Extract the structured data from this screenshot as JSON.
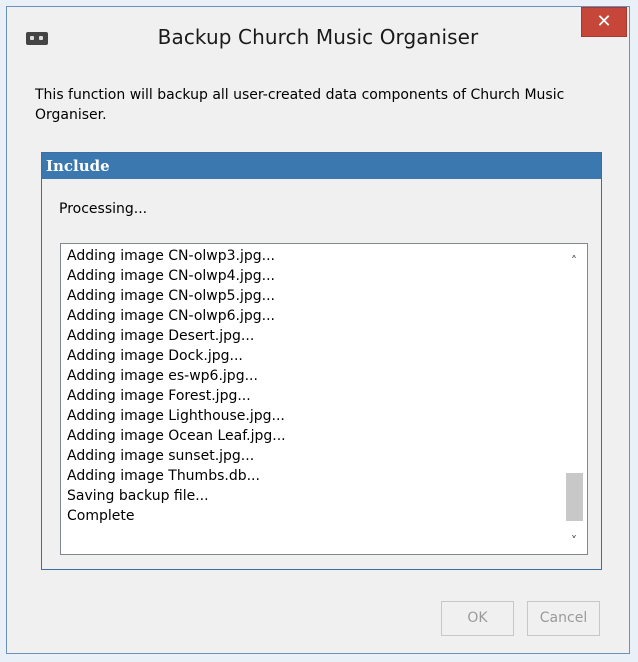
{
  "window": {
    "title": "Backup Church Music Organiser",
    "close_glyph": "✕"
  },
  "description": "This function will backup all user-created data components of Church Music Organiser.",
  "group": {
    "header": "Include",
    "status": "Processing..."
  },
  "log": [
    "Adding image CN-olwp3.jpg...",
    "Adding image CN-olwp4.jpg...",
    "Adding image CN-olwp5.jpg...",
    "Adding image CN-olwp6.jpg...",
    "Adding image Desert.jpg...",
    "Adding image Dock.jpg...",
    "Adding image es-wp6.jpg...",
    "Adding image Forest.jpg...",
    "Adding image Lighthouse.jpg...",
    "Adding image Ocean Leaf.jpg...",
    "Adding image sunset.jpg...",
    "Adding image Thumbs.db...",
    "Saving backup file...",
    "Complete"
  ],
  "buttons": {
    "ok": "OK",
    "cancel": "Cancel"
  },
  "icons": {
    "app": "app-icon",
    "close": "close-icon",
    "scroll_up": "chevron-up-icon",
    "scroll_down": "chevron-down-icon"
  },
  "colors": {
    "group_header": "#3c78b0",
    "close_button": "#c7463a",
    "window_frame": "#eaf0f7"
  }
}
